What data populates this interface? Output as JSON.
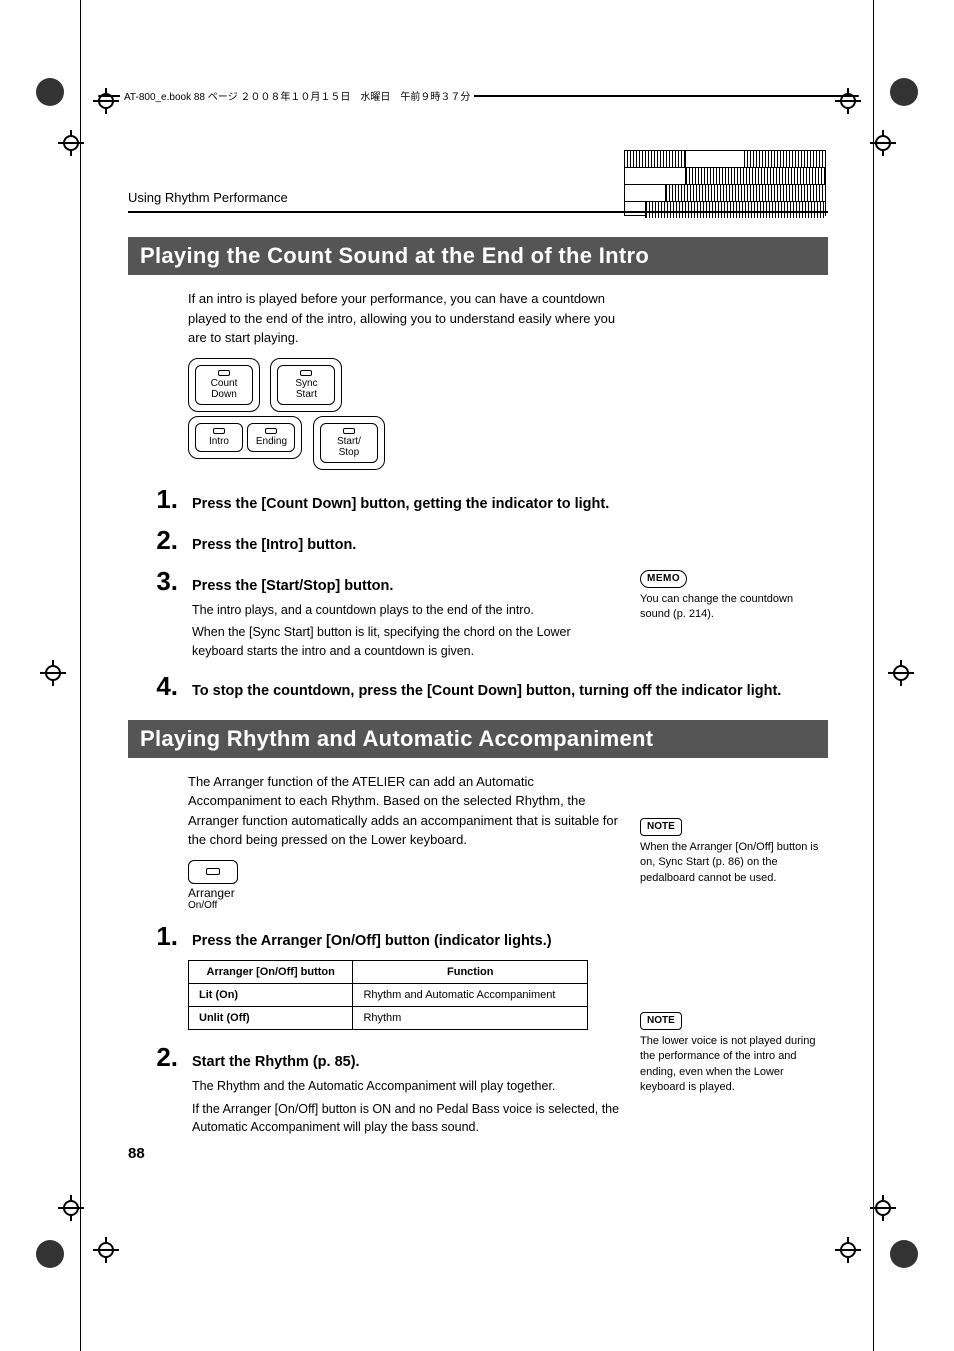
{
  "header": {
    "file_info": "AT-800_e.book  88 ページ  ２００８年１０月１５日　水曜日　午前９時３７分"
  },
  "running_head": "Using Rhythm Performance",
  "section1": {
    "title": "Playing the Count Sound at the End of the Intro",
    "intro": "If an intro is played before your performance, you can have a countdown played to the end of the intro, allowing you to understand easily where you are to start playing.",
    "buttons": {
      "count_down": "Count\nDown",
      "sync_start": "Sync\nStart",
      "intro": "Intro",
      "ending": "Ending",
      "start_stop": "Start/\nStop"
    },
    "steps": [
      {
        "n": "1.",
        "t": "Press the [Count Down] button, getting the indicator to light."
      },
      {
        "n": "2.",
        "t": "Press the [Intro] button."
      },
      {
        "n": "3.",
        "t": "Press the [Start/Stop] button.",
        "sub": [
          "The intro plays, and a countdown plays to the end of the intro.",
          "When the [Sync Start] button is lit, specifying the chord on the Lower keyboard starts the intro and a countdown is given."
        ]
      },
      {
        "n": "4.",
        "t": "To stop the countdown, press the [Count Down] button, turning off the indicator light."
      }
    ],
    "memo": {
      "label": "MEMO",
      "text": "You can change the countdown sound (p. 214)."
    }
  },
  "section2": {
    "title": "Playing Rhythm and Automatic Accompaniment",
    "intro": "The Arranger function of the ATELIER can add an Automatic Accompaniment to each Rhythm. Based on the selected Rhythm, the Arranger function automatically adds an accompaniment that is suitable for the chord being pressed on the Lower keyboard.",
    "arranger_label": "Arranger",
    "arranger_sub": "On/Off",
    "steps": [
      {
        "n": "1.",
        "t": "Press the Arranger [On/Off] button (indicator lights.)"
      },
      {
        "n": "2.",
        "t": "Start the Rhythm (p. 85).",
        "sub": [
          "The Rhythm and the Automatic Accompaniment will play together.",
          "If the Arranger [On/Off] button is ON and no Pedal Bass voice is selected, the Automatic Accompaniment will play the bass sound."
        ]
      }
    ],
    "table": {
      "headers": [
        "Arranger [On/Off] button",
        "Function"
      ],
      "rows": [
        [
          "Lit (On)",
          "Rhythm and Automatic Accompaniment"
        ],
        [
          "Unlit (Off)",
          "Rhythm"
        ]
      ]
    },
    "note1": {
      "label": "NOTE",
      "text": "When the Arranger [On/Off] button is on, Sync Start (p. 86) on the pedalboard cannot be used."
    },
    "note2": {
      "label": "NOTE",
      "text": "The lower voice is not played during the performance of the intro and ending, even when the Lower keyboard is played."
    }
  },
  "page_number": "88"
}
